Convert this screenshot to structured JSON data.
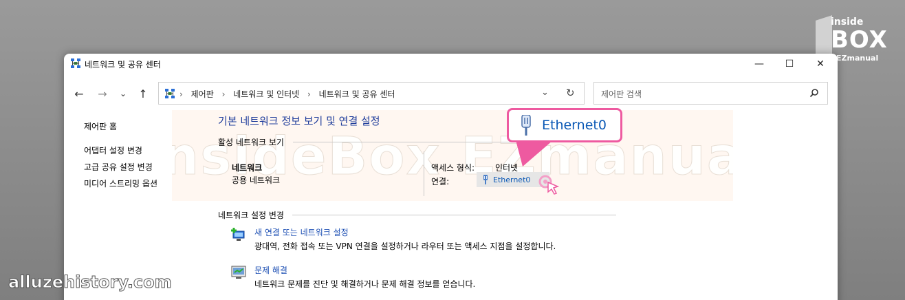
{
  "brand": {
    "line1": "inside",
    "line2": "BOX",
    "line3": "EZmanual"
  },
  "window": {
    "title": "네트워크 및 공유 센터",
    "controls": {
      "minimize": "—",
      "maximize": "☐",
      "close": "✕"
    }
  },
  "nav": {
    "back": "←",
    "forward": "→",
    "recent": "⌄",
    "up": "↑",
    "breadcrumbs": [
      "제어판",
      "네트워크 및 인터넷",
      "네트워크 및 공유 센터"
    ],
    "separator": "›",
    "dropdown": "⌄",
    "refresh": "↻",
    "search_placeholder": "제어판 검색"
  },
  "sidebar": {
    "home": "제어판 홈",
    "items": [
      "어댑터 설정 변경",
      "고급 공유 설정 변경",
      "미디어 스트리밍 옵션"
    ]
  },
  "main": {
    "title": "기본 네트워크 정보 보기 및 연결 설정",
    "active_section": "활성 네트워크 보기",
    "network_name": "네트워크",
    "network_type": "공용 네트워크",
    "access_label": "액세스 형식:",
    "access_value": "인터넷",
    "connection_label": "연결:",
    "connection_value": "Ethernet0",
    "settings_section": "네트워크 설정 변경",
    "tasks": [
      {
        "link": "새 연결 또는 네트워크 설정",
        "desc": "광대역, 전화 접속 또는 VPN 연결을 설정하거나 라우터 또는 액세스 지점을 설정합니다."
      },
      {
        "link": "문제 해결",
        "desc": "네트워크 문제를 진단 및 해결하거나 문제 해결 정보를 얻습니다."
      }
    ]
  },
  "callout": {
    "text": "Ethernet0"
  },
  "watermark": "insideBox EZmanual",
  "footer_watermark": "alluzehistory.com",
  "colors": {
    "link": "#1e50b4",
    "title": "#1e3c9b",
    "callout_border": "#ee5aa0"
  }
}
